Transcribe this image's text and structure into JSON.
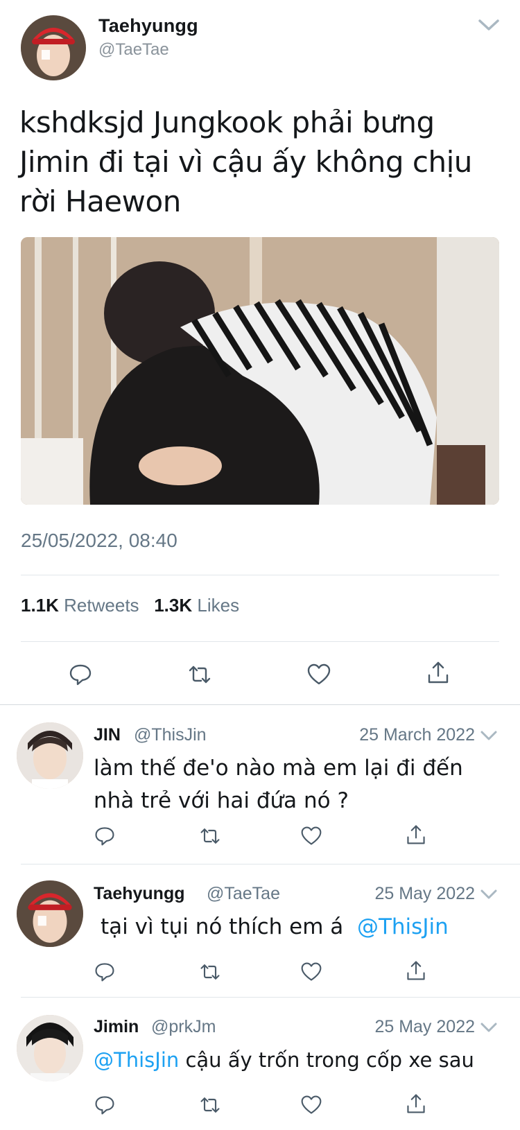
{
  "main_tweet": {
    "name": "Taehyungg",
    "handle": "@TaeTae",
    "text": "kshdksjd Jungkook phải bưng Jimin đi tại vì cậu ấy không chịu rời Haewon",
    "timestamp": "25/05/2022, 08:40",
    "retweets_count": "1.1K",
    "retweets_label": "Retweets",
    "likes_count": "1.3K",
    "likes_label": "Likes"
  },
  "replies": [
    {
      "name": "JIN",
      "handle": "@ThisJin",
      "date": "25 March 2022",
      "text": "làm thế đe'o nào mà em lại đi đến nhà trẻ với hai đứa nó ?"
    },
    {
      "name": "Taehyungg",
      "handle": "@TaeTae",
      "date": "25 May 2022",
      "text": "tại vì tụi nó thích em á",
      "mention": "@ThisJin"
    },
    {
      "name": "Jimin",
      "handle": "@prkJm",
      "date": "25 May 2022",
      "mention": "@ThisJin",
      "text": "cậu ấy trốn trong cốp xe sau"
    }
  ],
  "colors": {
    "text": "#14171a",
    "secondary": "#657786",
    "mention": "#1da1f2",
    "divider": "#e1e6ea"
  },
  "icons": [
    "reply-icon",
    "retweet-icon",
    "like-icon",
    "share-icon",
    "chevron-down-icon"
  ]
}
